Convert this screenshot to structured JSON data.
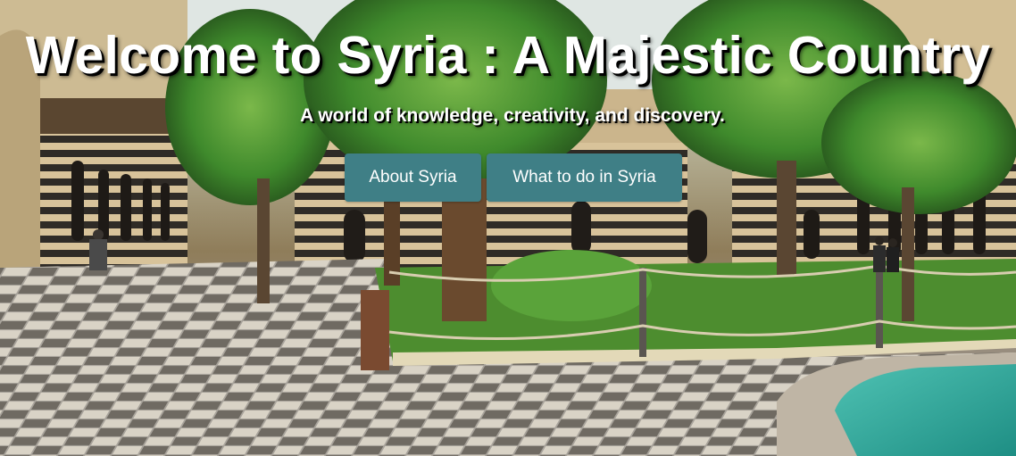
{
  "hero": {
    "title": "Welcome to Syria : A Majestic Country",
    "subtitle": "A world of knowledge, creativity, and discovery.",
    "buttons": [
      {
        "label": "About Syria"
      },
      {
        "label": "What to do in Syria"
      }
    ]
  },
  "colors": {
    "button_bg": "#3f7f86",
    "text": "#ffffff",
    "text_shadow": "#000000"
  }
}
